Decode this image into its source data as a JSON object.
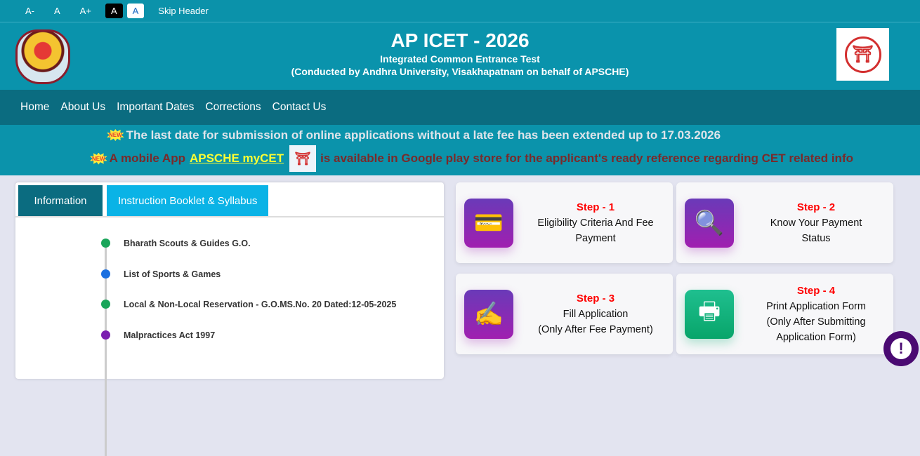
{
  "topbar": {
    "font_decrease": "A-",
    "font_normal": "A",
    "font_increase": "A+",
    "contrast_dark": "A",
    "contrast_light": "A",
    "skip": "Skip Header"
  },
  "header": {
    "title": "AP ICET - 2026",
    "subtitle": "Integrated Common Entrance Test",
    "conducted": "(Conducted by Andhra University, Visakhapatnam on behalf of APSCHE)"
  },
  "nav": [
    "Home",
    "About Us",
    "Important Dates",
    "Corrections",
    "Contact Us"
  ],
  "notices": {
    "badge": "NEW",
    "line1": "The last date for submission of online applications without a late fee has been extended up to 17.03.2026",
    "line2_prefix": "A mobile App",
    "app_link": "APSCHE myCET",
    "line2_suffix": "is available in Google play store for the applicant's ready reference regarding CET related info"
  },
  "tabs": [
    "Information",
    "Instruction Booklet & Syllabus"
  ],
  "info_items": [
    {
      "label": "Bharath Scouts & Guides G.O.",
      "color": "#1aa55a"
    },
    {
      "label": "List of Sports & Games",
      "color": "#1a6fe0"
    },
    {
      "label": "Local & Non-Local Reservation - G.O.MS.No. 20 Dated:12-05-2025",
      "color": "#1aa55a"
    },
    {
      "label": "Malpractices Act 1997",
      "color": "#7b1fb0"
    }
  ],
  "steps": [
    {
      "step": "Step - 1",
      "line1": "Eligibility Criteria And Fee",
      "line2": "Payment",
      "line3": ""
    },
    {
      "step": "Step - 2",
      "line1": "Know Your Payment",
      "line2": "Status",
      "line3": ""
    },
    {
      "step": "Step - 3",
      "line1": "Fill Application",
      "line2": "(Only After Fee Payment)",
      "line3": ""
    },
    {
      "step": "Step - 4",
      "line1": "Print Application Form",
      "line2": "(Only After Submitting",
      "line3": "Application Form)"
    }
  ],
  "help": "!"
}
